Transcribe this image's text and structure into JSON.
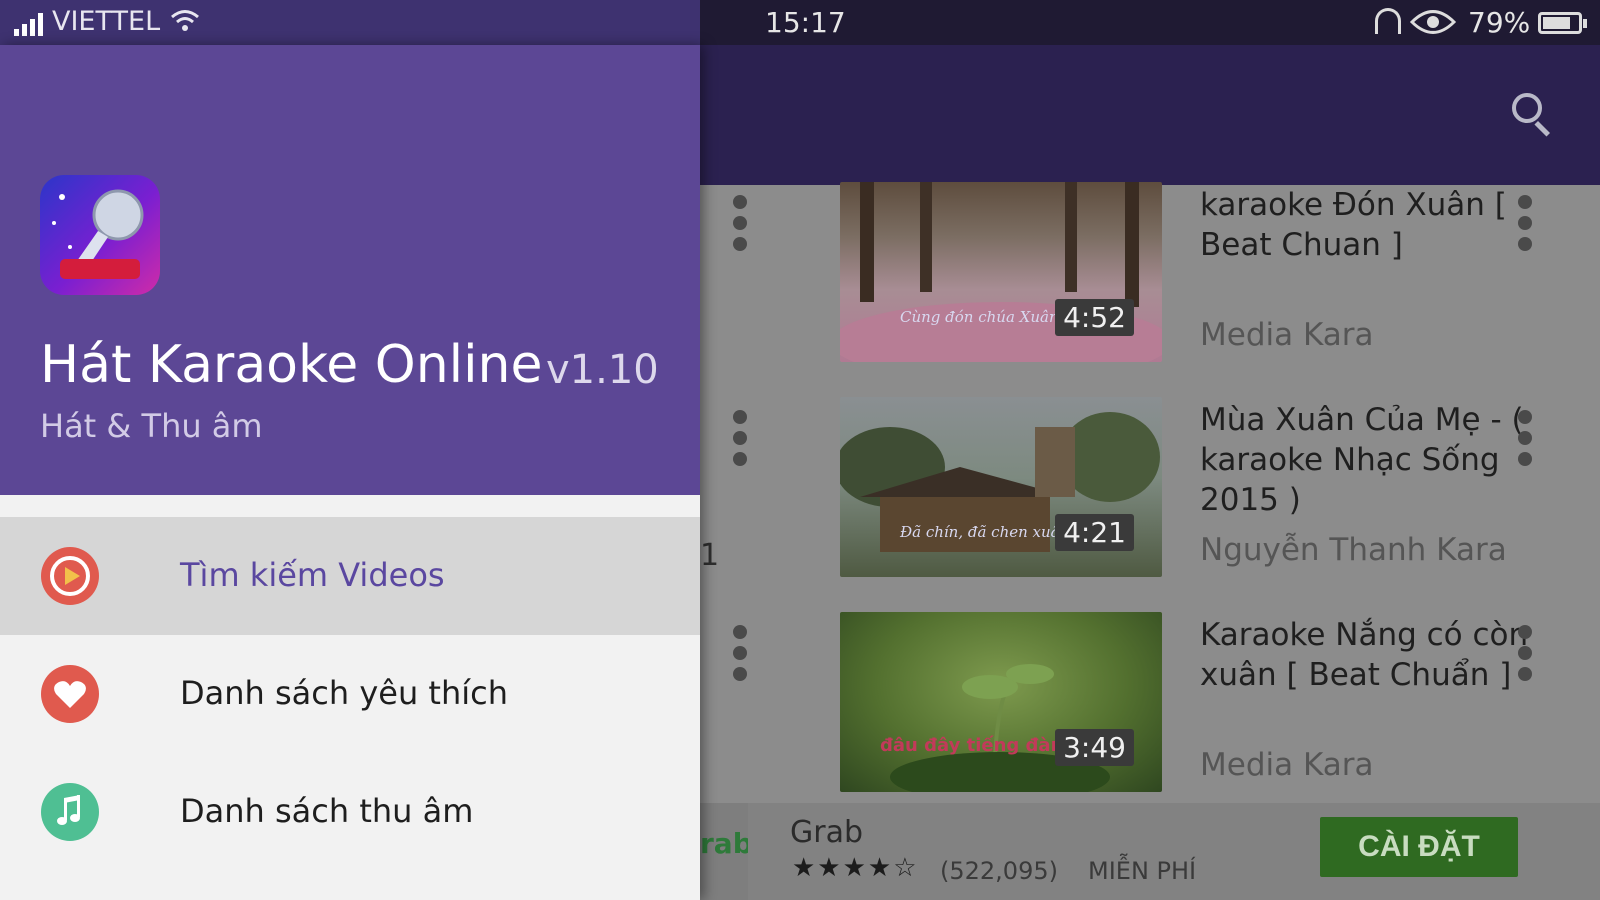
{
  "status_bar": {
    "carrier": "VIETTEL",
    "time": "15:17",
    "battery_percent": "79%",
    "battery_level": 0.79,
    "icons": [
      "signal-icon",
      "wifi-icon",
      "headset-icon",
      "eye-icon",
      "battery-icon"
    ]
  },
  "toolbar": {
    "search_icon": "search-icon"
  },
  "videos": [
    {
      "title": "karaoke Đón Xuân [ Beat Chuan ]",
      "channel": "Media Kara",
      "duration": "4:52",
      "caption": "Cùng đón chúa Xuân"
    },
    {
      "title": "Mùa Xuân Của Mẹ - ( karaoke Nhạc Sống 2015 )",
      "channel": "Nguyễn Thanh Kara",
      "duration": "4:21",
      "caption": "Đã chín, đã chen xuân đã"
    },
    {
      "title": "Karaoke Nắng có còn xuân [ Beat Chuẩn ]",
      "channel": "Media Kara",
      "duration": "3:49",
      "caption": "đâu đây tiếng đàn"
    }
  ],
  "side_number": "1",
  "ad": {
    "logo_text": "rab",
    "title": "Grab",
    "stars": "★★★★☆",
    "rating_value": 4.5,
    "reviews": "(522,095)",
    "price": "MIỄN PHÍ",
    "install_label": "CÀI ĐẶT"
  },
  "drawer": {
    "app_title": "Hát Karaoke Online",
    "version": "v1.10",
    "subtitle": "Hát & Thu âm",
    "menu": [
      {
        "label": "Tìm kiếm Videos",
        "icon": "play-circle-icon",
        "color": "#e05a4e",
        "active": true
      },
      {
        "label": "Danh sách yêu thích",
        "icon": "heart-icon",
        "color": "#e05a4e",
        "active": false
      },
      {
        "label": "Danh sách thu âm",
        "icon": "music-note-icon",
        "color": "#4fbf93",
        "active": false
      }
    ]
  },
  "colors": {
    "drawer_header": "#5c4795",
    "status_bar": "#3e3270",
    "accent": "#5a47a0",
    "install_button": "#2f6a21"
  }
}
